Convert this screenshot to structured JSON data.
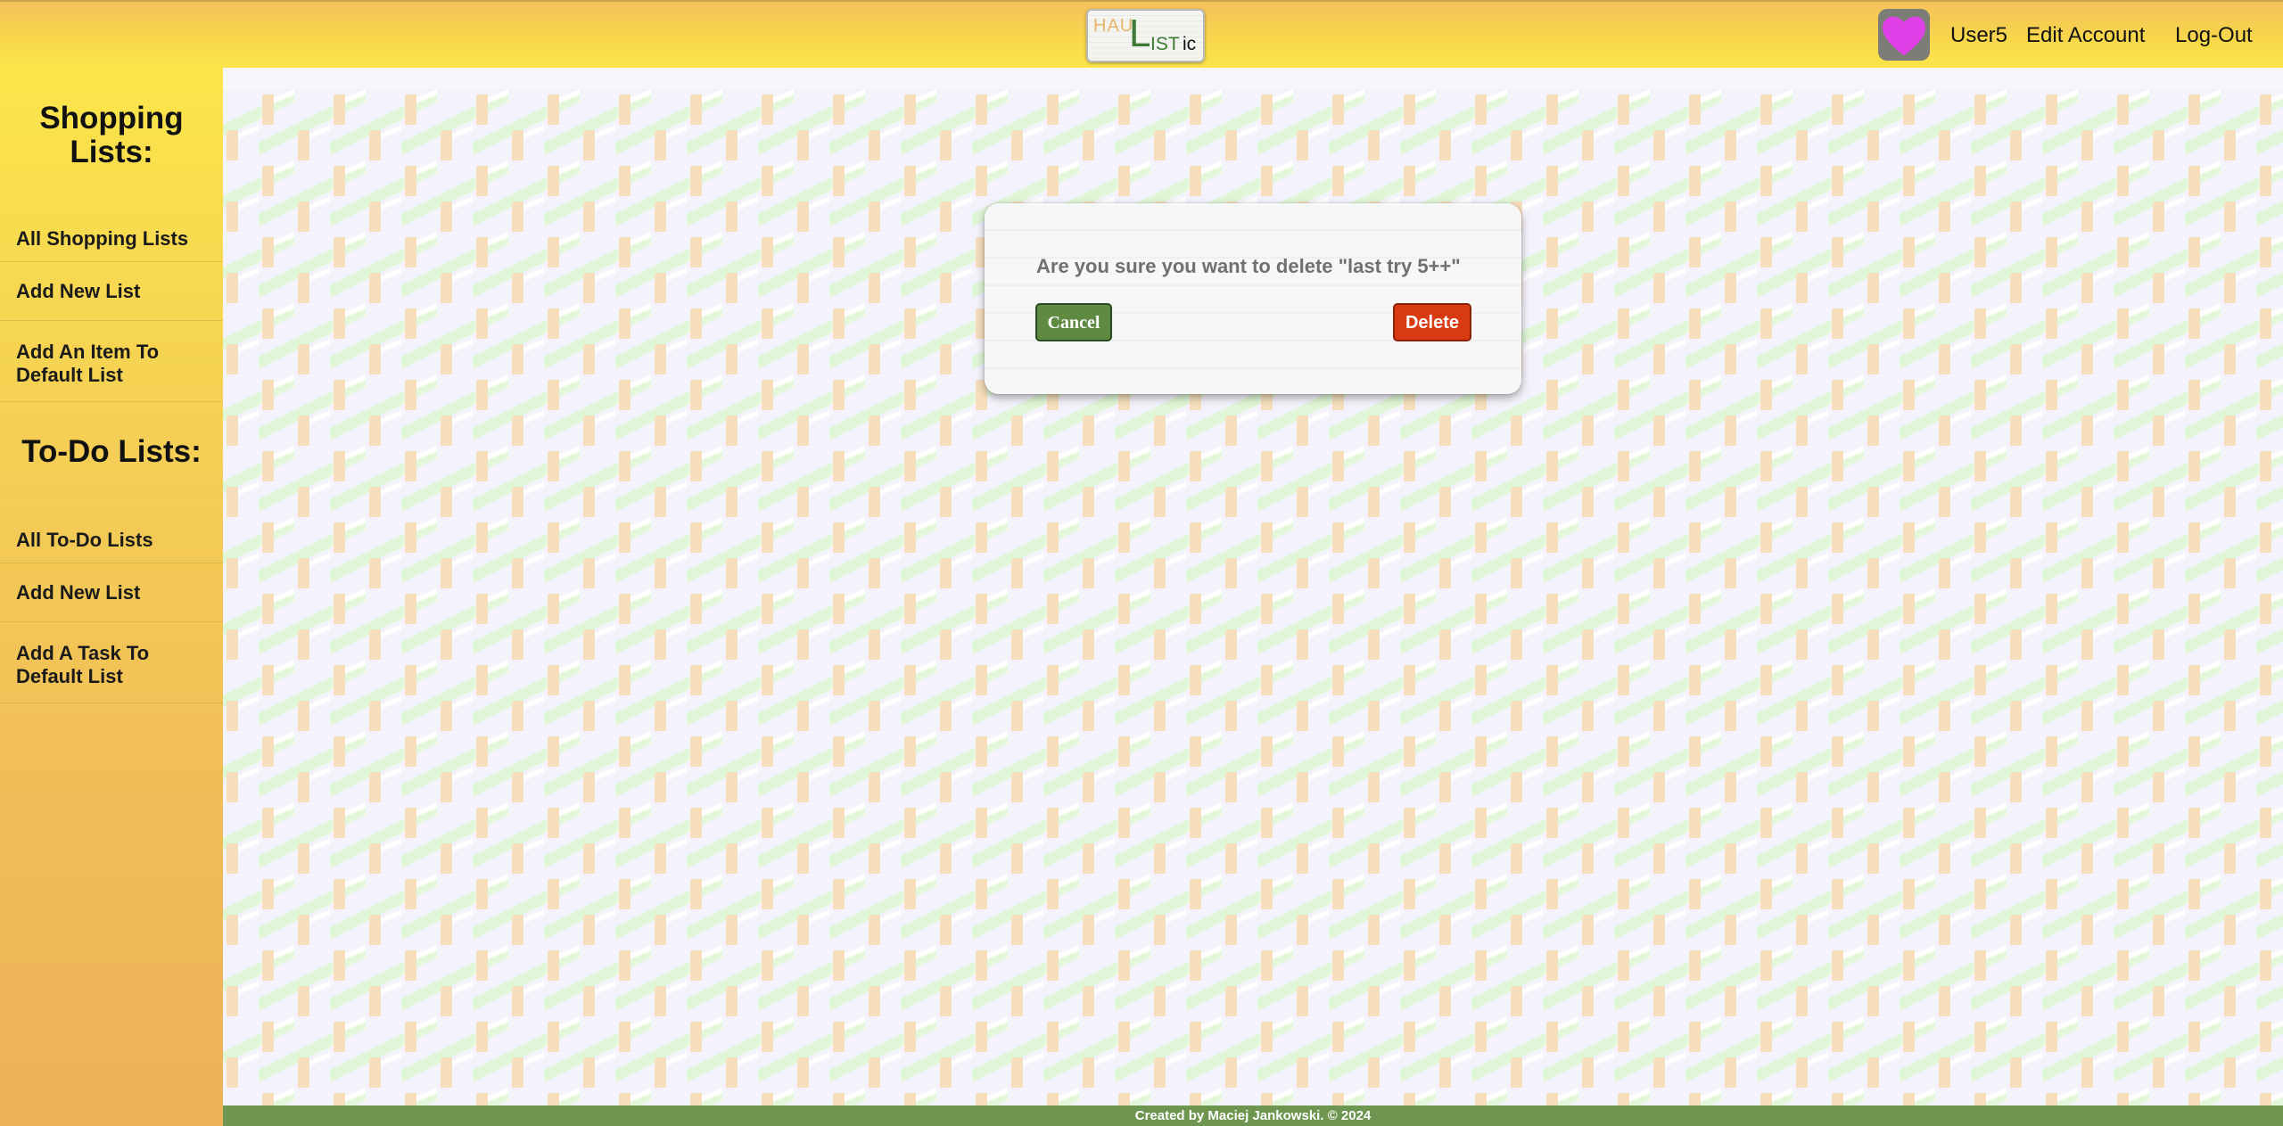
{
  "header": {
    "logo": {
      "hau": "HAU",
      "l": "L",
      "ist": "IST",
      "ic": "ic"
    },
    "avatar_icon": "heart-avatar-icon",
    "username": "User5",
    "edit_account": "Edit Account",
    "logout": "Log-Out"
  },
  "sidebar": {
    "shopping_heading_line1": "Shopping",
    "shopping_heading_line2": "Lists:",
    "shopping_items": [
      {
        "label": "All Shopping Lists"
      },
      {
        "label": "Add New List"
      },
      {
        "label_line1": "Add An Item To",
        "label_line2": "Default List"
      }
    ],
    "todo_heading": "To-Do Lists:",
    "todo_items": [
      {
        "label": "All To-Do Lists"
      },
      {
        "label": "Add New List"
      },
      {
        "label_line1": "Add A Task To",
        "label_line2": "Default List"
      }
    ]
  },
  "modal": {
    "message": "Are you sure you want to delete \"last try 5++\"",
    "cancel_label": "Cancel",
    "delete_label": "Delete"
  },
  "footer": {
    "text": "Created by Maciej Jankowski. © 2024"
  },
  "colors": {
    "header_yellow": "#f8d84a",
    "footer_green": "#6e9651",
    "cancel_green": "#5e8a42",
    "delete_red": "#d83a12",
    "avatar_heart": "#e040e8"
  }
}
